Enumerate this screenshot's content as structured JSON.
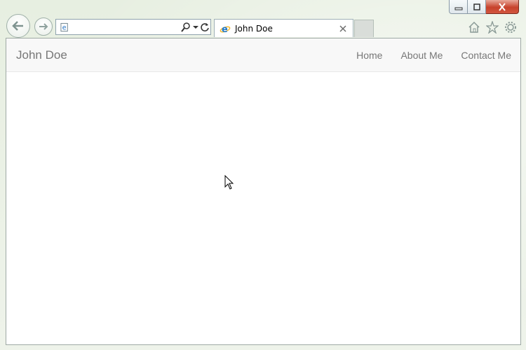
{
  "browser": {
    "address_value": "",
    "tab_title": "John Doe",
    "tab_close_glyph": "×",
    "icons": [
      "back-arrow-icon",
      "forward-arrow-icon",
      "ie-favicon-icon",
      "search-icon",
      "refresh-icon",
      "home-icon",
      "star-icon",
      "gear-icon",
      "minimize-icon",
      "maximize-icon",
      "close-icon"
    ]
  },
  "page": {
    "brand": "John Doe",
    "nav": [
      {
        "label": "Home"
      },
      {
        "label": "About Me"
      },
      {
        "label": "Contact Me"
      }
    ]
  },
  "colors": {
    "navbar_bg": "#f8f8f8",
    "nav_text": "#777777",
    "close_button": "#c7422c"
  }
}
